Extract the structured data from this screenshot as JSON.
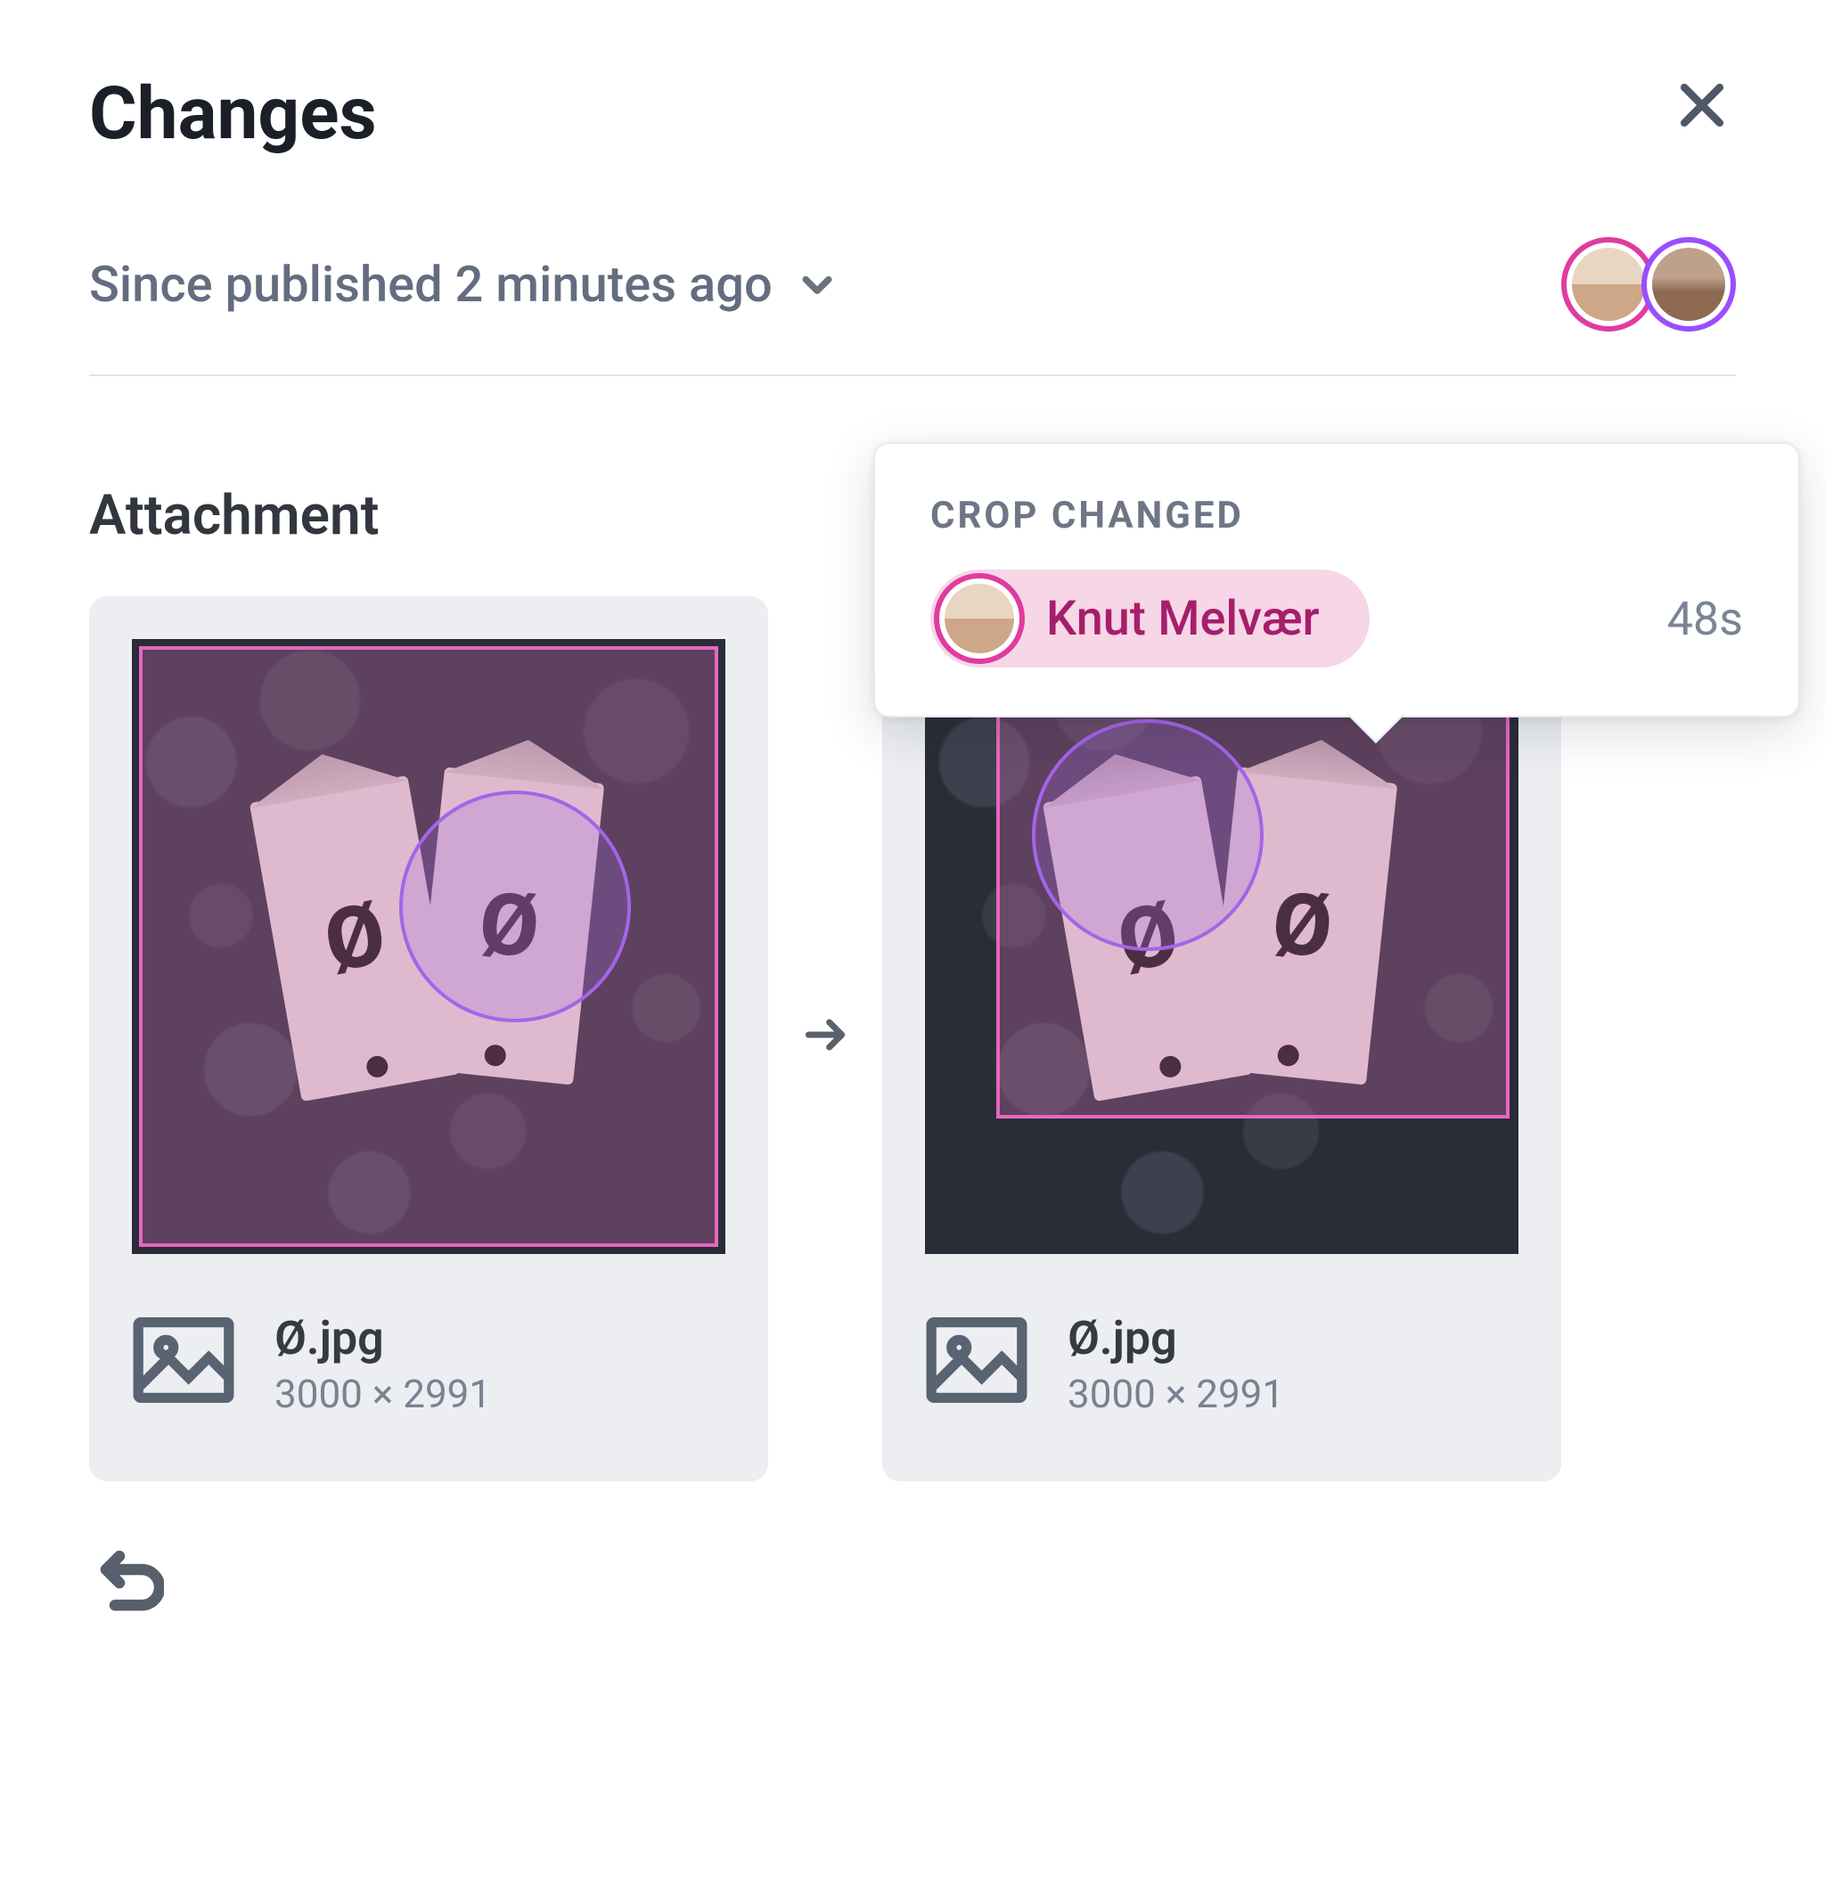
{
  "header": {
    "title": "Changes"
  },
  "since": {
    "label": "Since published 2 minutes ago"
  },
  "section": {
    "label": "Attachment"
  },
  "tooltip": {
    "title": "CROP CHANGED",
    "user": "Knut Melvær",
    "timestamp": "48s"
  },
  "before": {
    "filename": "Ø.jpg",
    "dimensions": "3000 × 2991"
  },
  "after": {
    "filename": "Ø.jpg",
    "dimensions": "3000 × 2991"
  },
  "colors": {
    "avatar_ring_1": "#e03ba0",
    "avatar_ring_2": "#9b4dff",
    "crop_border": "#e766c0",
    "hotspot_border": "#a564e8"
  }
}
